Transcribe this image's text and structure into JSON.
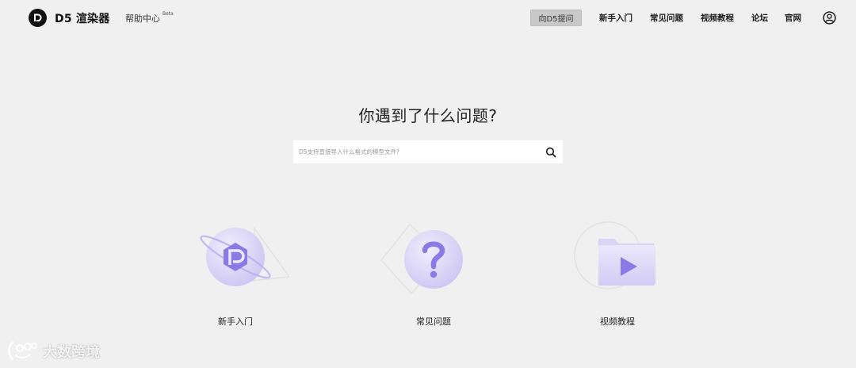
{
  "header": {
    "logo_text": "D5 渲染器",
    "help_center": "帮助中心",
    "beta": "Beta",
    "ask_button": "向D5提问",
    "nav": [
      "新手入门",
      "常见问题",
      "视频教程",
      "论坛",
      "官网"
    ]
  },
  "hero": {
    "title": "你遇到了什么问题?",
    "search_placeholder": "D5支持直接导入什么格式的模型文件?"
  },
  "cards": [
    {
      "label": "新手入门",
      "icon": "hexagon-logo-icon"
    },
    {
      "label": "常见问题",
      "icon": "question-mark-icon"
    },
    {
      "label": "视频教程",
      "icon": "video-folder-icon"
    }
  ],
  "watermark": {
    "text": "大数跨境"
  },
  "colors": {
    "background": "#f0f0f0",
    "accent_purple": "#8b7ae6",
    "ask_button_bg": "#c8c8c8"
  }
}
